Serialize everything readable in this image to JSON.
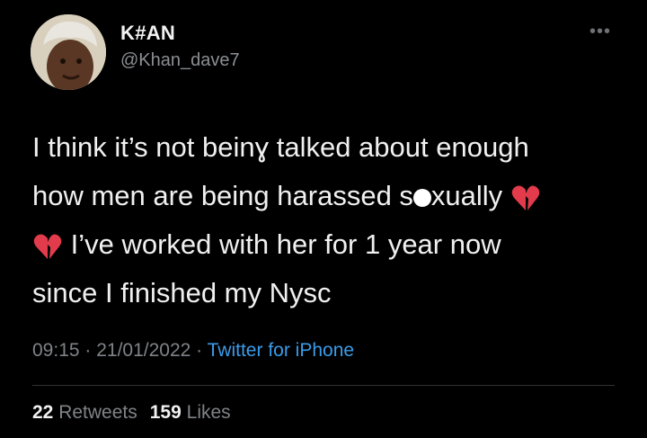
{
  "author": {
    "display_name": "K#AN",
    "handle": "@Khan_dave7"
  },
  "more_icon": "more-horizontal-icon",
  "tweet": {
    "line1": "I think it’s not beinɣ talked about enough",
    "line2_pre": "how men are being harassed s",
    "line2_post": "xually ",
    "line3_post": " I’ve worked with her for 1 year now",
    "line4": "since I finished my Nysc",
    "emoji": "broken-heart-icon"
  },
  "meta": {
    "time": "09:15",
    "sep1": " · ",
    "date": "21/01/2022",
    "sep2": " · ",
    "source": "Twitter for iPhone"
  },
  "stats": {
    "retweets_count": "22",
    "retweets_label": "Retweets",
    "likes_count": "159",
    "likes_label": "Likes"
  },
  "colors": {
    "background": "#000000",
    "text": "#f0f0f0",
    "secondary": "#7f8388",
    "link": "#3b9be8",
    "heart": "#e23b4b"
  }
}
